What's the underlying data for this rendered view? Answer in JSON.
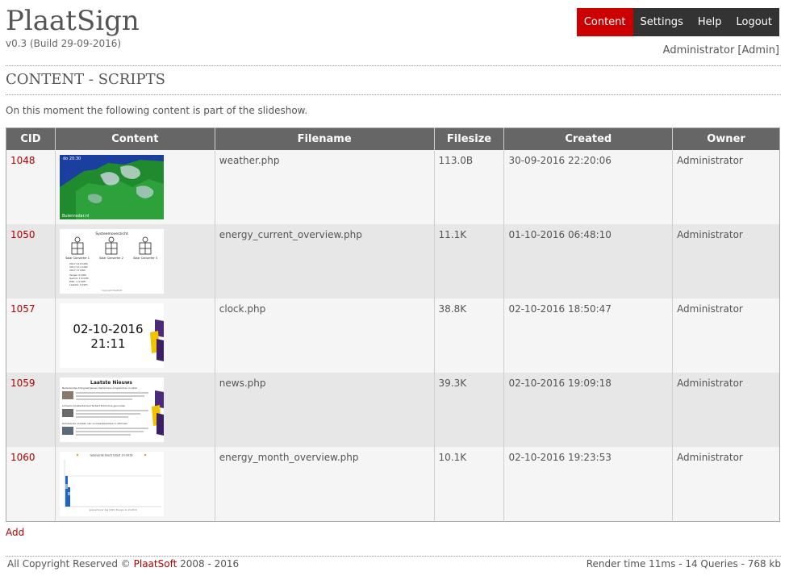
{
  "app": {
    "title": "PlaatSign",
    "version": "v0.3 (Build 29-09-2016)"
  },
  "nav": [
    {
      "label": "Content",
      "active": true
    },
    {
      "label": "Settings",
      "active": false
    },
    {
      "label": "Help",
      "active": false
    },
    {
      "label": "Logout",
      "active": false
    }
  ],
  "user": {
    "line": "Administrator [Admin]"
  },
  "page": {
    "title": "CONTENT - SCRIPTS",
    "intro": "On this moment the following content is part of the slideshow."
  },
  "table": {
    "headers": [
      "CID",
      "Content",
      "Filename",
      "Filesize",
      "Created",
      "Owner"
    ],
    "rows": [
      {
        "cid": "1048",
        "thumb": "weather-radar-thumbnail",
        "filename": "weather.php",
        "filesize": "113.0B",
        "created": "30-09-2016 22:20:06",
        "owner": "Administrator"
      },
      {
        "cid": "1050",
        "thumb": "energy-current-thumbnail",
        "filename": "energy_current_overview.php",
        "filesize": "11.1K",
        "created": "01-10-2016 06:48:10",
        "owner": "Administrator"
      },
      {
        "cid": "1057",
        "thumb": "clock-thumbnail",
        "filename": "clock.php",
        "filesize": "38.8K",
        "created": "02-10-2016 18:50:47",
        "owner": "Administrator"
      },
      {
        "cid": "1059",
        "thumb": "news-thumbnail",
        "filename": "news.php",
        "filesize": "39.3K",
        "created": "02-10-2016 19:09:18",
        "owner": "Administrator"
      },
      {
        "cid": "1060",
        "thumb": "energy-month-thumbnail",
        "filename": "energy_month_overview.php",
        "filesize": "10.1K",
        "created": "02-10-2016 19:23:53",
        "owner": "Administrator"
      }
    ]
  },
  "thumbs": {
    "weather": {
      "time": "do 20:30",
      "brand": "Buienradar.nl"
    },
    "energy": {
      "title": "Systeemoverzicht",
      "labels": [
        "Solar Converter 1",
        "Solar Converter 2",
        "Solar Converter 3"
      ],
      "stats": [
        "2017 11 8 kWh",
        "2017 17.1 kWh",
        "2017 17 kWh",
        "Vergel: 0 kWh",
        "Gemid: 1.8 kWh",
        "Piek: 1.4 kWh",
        "Laatste: 0 kWh"
      ],
      "footer": "Copyright PlaatSoft"
    },
    "clock": {
      "date": "02-10-2016",
      "time": "21:11"
    },
    "news": {
      "title": "Laatste Nieuws",
      "items": [
        "Nederlandse fotograaf Jeroen Oerlemans omgekomen in Libië",
        "Lichaam Amsterdamse Herbert Eckholme gevonden",
        "Onbekende oorzaak van vuurwerkexplosie in Alkmaar"
      ]
    },
    "energymonth": {
      "title": "Geleverde Electriciteit 10-2016",
      "xlabel": "geleverde per dag (kWh) Energie 11-10-2016"
    }
  },
  "add_label": "Add",
  "footer": {
    "prefix": "All Copyright Reserved © ",
    "brand": "PlaatSoft",
    "suffix": " 2008 - 2016",
    "render": "Render time 11ms - 14 Queries - 768 kb"
  },
  "colors": {
    "accent": "#cc0000",
    "link": "#b20000",
    "nav_bg": "#333333",
    "header_bg": "#666666"
  }
}
